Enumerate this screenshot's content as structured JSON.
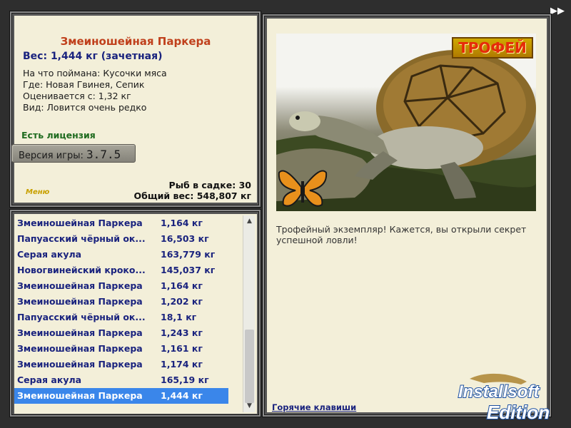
{
  "fish": {
    "title": "Змеиношейная Паркера",
    "weight": "Вес: 1,444 кг (зачетная)",
    "details": [
      "На что поймана: Кусочки мяса",
      "Где: Новая Гвинея, Сепик",
      "Оценивается с: 1,32 кг",
      "Вид: Ловится очень редко"
    ],
    "license": "Есть лицензия"
  },
  "version": {
    "label": "Версия игры:",
    "number": "3.7.5"
  },
  "menu_link": "Меню",
  "stats": {
    "fish_in_keepnet": "Рыб в садке: 30",
    "total_weight": "Общий вес: 548,807 кг"
  },
  "catch_list": [
    {
      "name": "Змеиношейная Паркера",
      "weight": "1,164 кг"
    },
    {
      "name": "Папуасский чёрный ок...",
      "weight": "16,503 кг"
    },
    {
      "name": "Серая акула",
      "weight": "163,779 кг"
    },
    {
      "name": "Новогвинейский кроко...",
      "weight": "145,037 кг"
    },
    {
      "name": "Змеиношейная Паркера",
      "weight": "1,164 кг"
    },
    {
      "name": "Змеиношейная Паркера",
      "weight": "1,202 кг"
    },
    {
      "name": "Папуасский чёрный ок...",
      "weight": "18,1 кг"
    },
    {
      "name": "Змеиношейная Паркера",
      "weight": "1,243 кг"
    },
    {
      "name": "Змеиношейная Паркера",
      "weight": "1,161 кг"
    },
    {
      "name": "Змеиношейная Паркера",
      "weight": "1,174 кг"
    },
    {
      "name": "Серая акула",
      "weight": "165,19 кг"
    },
    {
      "name": "Змеиношейная Паркера",
      "weight": "1,444 кг",
      "selected": true
    }
  ],
  "trophy_badge": "ТРОФЕЙ",
  "description": "Трофейный экземпляр! Кажется, вы открыли секрет успешной ловли!",
  "hotkeys_link": "Горячие клавиши",
  "watermark": {
    "line1": "Installsoft",
    "line2": "Edition"
  },
  "colors": {
    "title": "#c0401c",
    "weight": "#1a237e",
    "license": "#1f6b1f",
    "list_text": "#1a237e",
    "selection": "#3a86ea",
    "panel_bg": "#f3efd9",
    "trophy_text": "#e62a0a"
  },
  "icons": {
    "fast_forward": "fast-forward-icon",
    "scroll_up": "scroll-up-icon",
    "scroll_down": "scroll-down-icon",
    "butterfly": "butterfly-icon",
    "turtle_photo": "turtle-photo"
  }
}
